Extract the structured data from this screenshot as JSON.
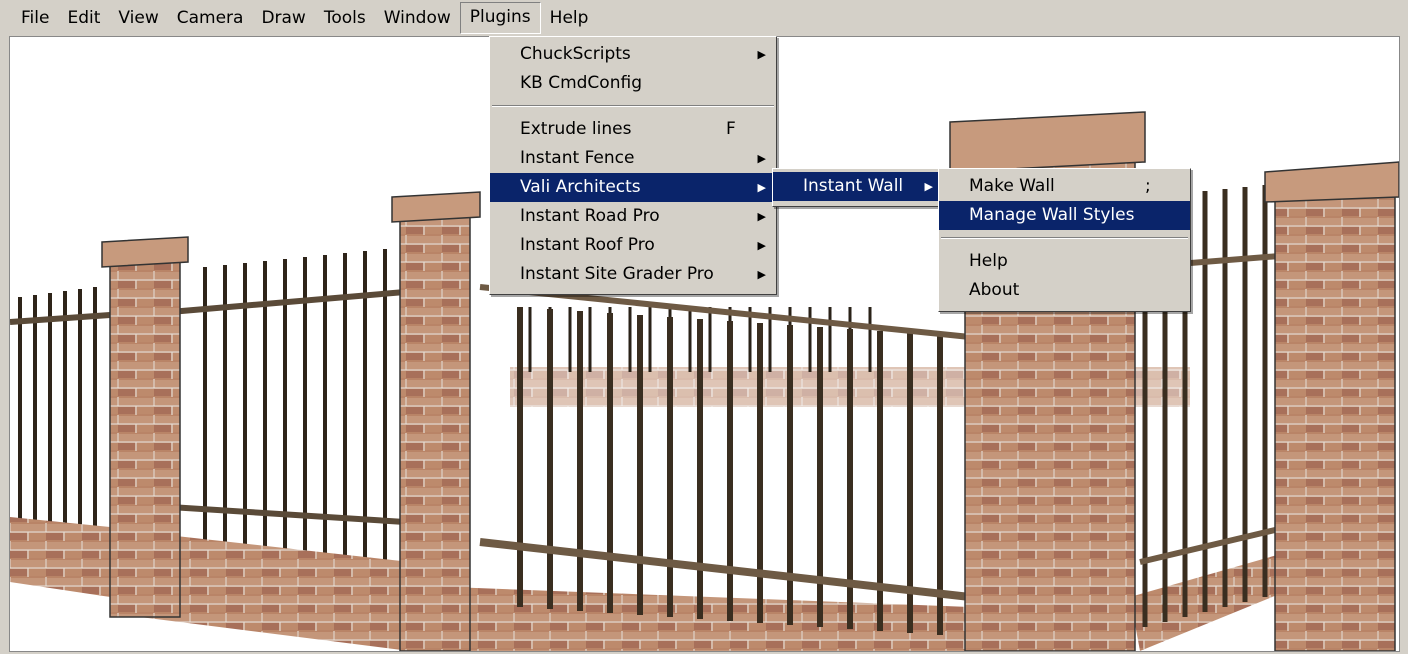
{
  "menubar": [
    "File",
    "Edit",
    "View",
    "Camera",
    "Draw",
    "Tools",
    "Window",
    "Plugins",
    "Help"
  ],
  "plugins_menu": [
    {
      "label": "ChuckScripts",
      "submenu": true
    },
    {
      "label": "KB CmdConfig"
    },
    {
      "sep": true
    },
    {
      "label": "Extrude lines",
      "shortcut": "F"
    },
    {
      "label": "Instant Fence",
      "submenu": true
    },
    {
      "label": "Vali Architects",
      "submenu": true,
      "highlight": true
    },
    {
      "label": "Instant Road Pro",
      "submenu": true
    },
    {
      "label": "Instant Roof Pro",
      "submenu": true
    },
    {
      "label": "Instant Site Grader Pro",
      "submenu": true
    }
  ],
  "vali_menu": [
    {
      "label": "Instant Wall",
      "submenu": true,
      "highlight": true
    }
  ],
  "wall_menu": [
    {
      "label": "Make Wall",
      "shortcut": ";"
    },
    {
      "label": "Manage Wall Styles",
      "highlight": true
    },
    {
      "sep": true
    },
    {
      "label": "Help"
    },
    {
      "label": "About"
    }
  ],
  "colors": {
    "highlight": "#0a246a",
    "menu_bg": "#d4d0c8",
    "brick": "#b07a5c",
    "bar": "#6e5a44"
  }
}
